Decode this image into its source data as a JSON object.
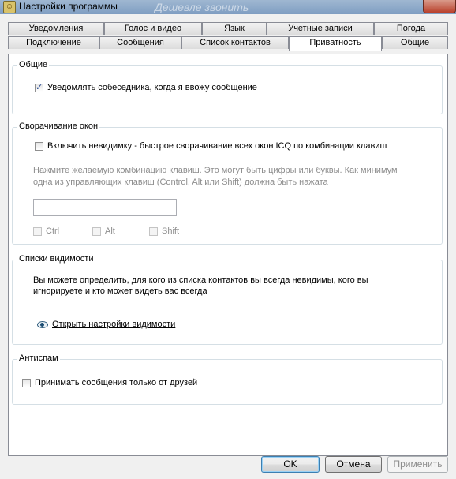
{
  "window": {
    "title": "Настройки программы",
    "background_title_text": "Дешевле звонить"
  },
  "tabs": {
    "row1": [
      "Уведомления",
      "Голос и видео",
      "Язык",
      "Учетные записи",
      "Погода"
    ],
    "row2": [
      "Подключение",
      "Сообщения",
      "Список контактов",
      "Приватность",
      "Общие"
    ],
    "active": "Приватность"
  },
  "groups": {
    "general": {
      "label": "Общие",
      "notify_typing": {
        "label": "Уведомлять собеседника, когда я ввожу сообщение",
        "checked": true
      }
    },
    "minimize": {
      "label": "Сворачивание окон",
      "invisible": {
        "label": "Включить невидимку - быстрое сворачивание всех окон ICQ по комбинации клавиш",
        "checked": false
      },
      "hint_line1": "Нажмите желаемую комбинацию клавиш. Это могут быть цифры или буквы. Как минимум",
      "hint_line2": "одна из управляющих клавиш (Control, Alt или Shift) должна быть нажата",
      "shortcut_value": "",
      "ctrl_label": "Ctrl",
      "alt_label": "Alt",
      "shift_label": "Shift"
    },
    "visibility": {
      "label": "Списки видимости",
      "text_line1": "Вы можете определить, для кого из списка контактов вы всегда невидимы, кого вы",
      "text_line2": "игнорируете и кто может видеть вас всегда",
      "link": "Открыть настройки видимости"
    },
    "antispam": {
      "label": "Антиспам",
      "friends_only": {
        "label": "Принимать сообщения только от друзей",
        "checked": false
      }
    }
  },
  "buttons": {
    "ok": "OK",
    "cancel": "Отмена",
    "apply": "Применить"
  }
}
